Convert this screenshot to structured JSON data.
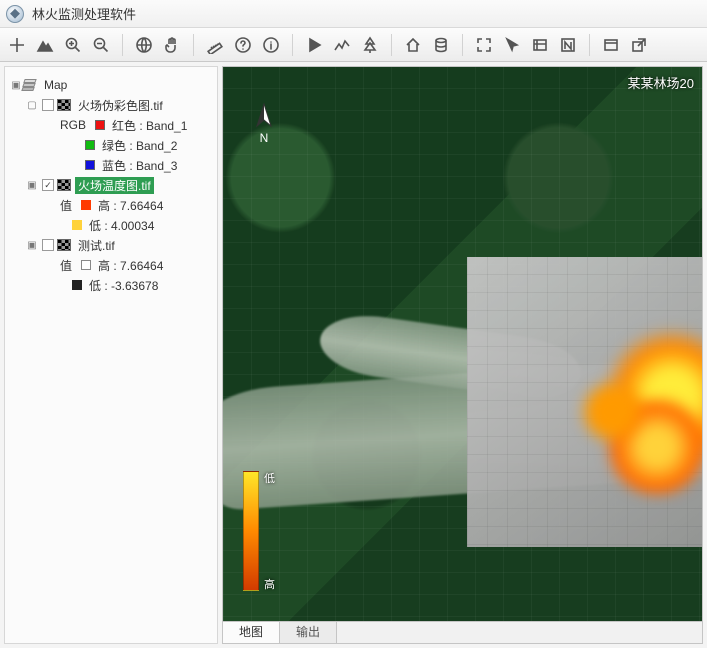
{
  "app": {
    "title": "林火监测处理软件"
  },
  "tree": {
    "root": "Map",
    "layer1": {
      "name": "火场伪彩色图.tif",
      "composite_label": "RGB",
      "bands": [
        {
          "label": "红色 : Band_1",
          "color": "#e11"
        },
        {
          "label": "绿色 : Band_2",
          "color": "#1b1"
        },
        {
          "label": "蓝色 : Band_3",
          "color": "#11d"
        }
      ]
    },
    "layer2": {
      "name": "火场温度图.tif",
      "value_label": "值",
      "high": "高 : 7.66464",
      "low": "低 : 4.00034"
    },
    "layer3": {
      "name": "测试.tif",
      "value_label": "值",
      "high": "高 : 7.66464",
      "low": "低 : -3.63678"
    }
  },
  "map": {
    "title_overlay": "某某林场20",
    "legend_low": "低",
    "legend_high": "高"
  },
  "tabs": {
    "map": "地图",
    "output": "输出"
  },
  "icons": {
    "add": "add-icon",
    "mountain": "mountain-icon",
    "zoomin": "zoom-in-icon",
    "zoomout": "zoom-out-icon",
    "globe": "globe-icon",
    "pan": "pan-icon",
    "ruler": "ruler-icon",
    "help": "help-icon",
    "info": "info-icon",
    "play": "play-icon",
    "trend": "trend-icon",
    "tree": "tree-icon",
    "home": "home-icon",
    "db": "database-icon",
    "full": "fullscreen-icon",
    "cursor": "cursor-icon",
    "coords": "coords-icon",
    "north": "north-icon",
    "window": "window-icon",
    "ext": "external-icon"
  }
}
